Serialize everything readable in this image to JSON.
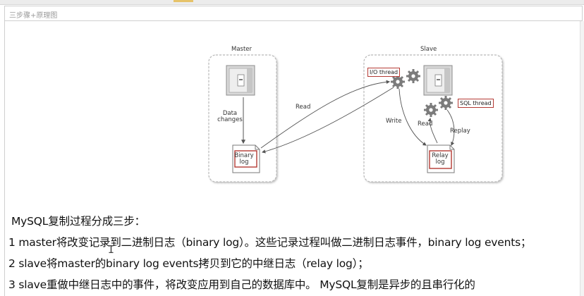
{
  "doc": {
    "title": "三步骤+原理图"
  },
  "diagram": {
    "master_title": "Master",
    "slave_title": "Slave",
    "data_changes": "Data\nchanges",
    "binary_log": "Binary\nlog",
    "read_left": "Read",
    "io_thread": "I/O thread",
    "sql_thread": "SQL thread",
    "write": "Write",
    "read_right": "Read",
    "replay": "Replay",
    "relay_log": "Relay\nlog",
    "colors": {
      "red_box": "#b43a34",
      "gear": "#7b7b7b",
      "dashed_border": "#b9b9b9"
    }
  },
  "text": {
    "heading": "MySQL复制过程分成三步：",
    "step1": "1 master将改变记录到二进制日志（binary log）。这些记录过程叫做二进制日志事件，binary log events；",
    "step2": "2 slave将master的binary log events拷贝到它的中继日志（relay log）；",
    "step3": "3 slave重做中继日志中的事件，将改变应用到自己的数据库中。 MySQL复制是异步的且串行化的"
  }
}
